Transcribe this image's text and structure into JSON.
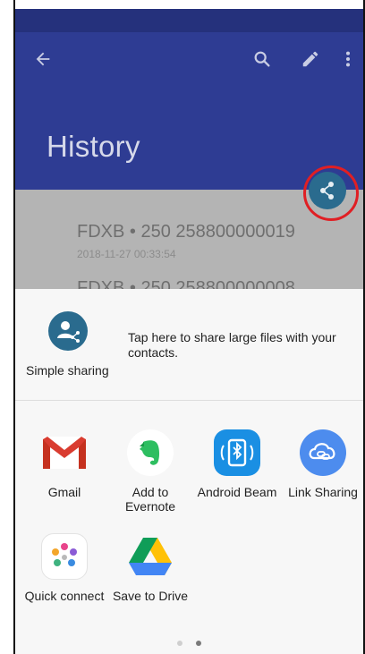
{
  "app": {
    "title": "History"
  },
  "toolbar": {
    "back_icon": "arrow-back-icon",
    "search_icon": "search-icon",
    "edit_icon": "pencil-icon",
    "more_icon": "more-vert-icon"
  },
  "history": {
    "items": [
      {
        "title": "FDXB • 250 258800000019",
        "timestamp": "2018-11-27 00:33:54"
      },
      {
        "title": "FDXB • 250 258800000008"
      }
    ]
  },
  "fab": {
    "icon": "share-icon"
  },
  "share_sheet": {
    "simple_sharing": {
      "label": "Simple sharing",
      "description": "Tap here to share large files with your contacts."
    },
    "apps": [
      {
        "label": "Gmail",
        "icon": "gmail-icon"
      },
      {
        "label": "Add to Evernote",
        "icon": "evernote-icon"
      },
      {
        "label": "Android Beam",
        "icon": "android-beam-icon"
      },
      {
        "label": "Link Sharing",
        "icon": "link-sharing-icon"
      },
      {
        "label": "Quick connect",
        "icon": "quick-connect-icon"
      },
      {
        "label": "Save to Drive",
        "icon": "google-drive-icon"
      }
    ],
    "page_indicator": {
      "pages": 2,
      "current": 2
    }
  },
  "colors": {
    "appbar": "#2e3c93",
    "statusbar": "#25317c",
    "fab": "#2a6b8e",
    "highlight_ring": "#e01f24"
  }
}
